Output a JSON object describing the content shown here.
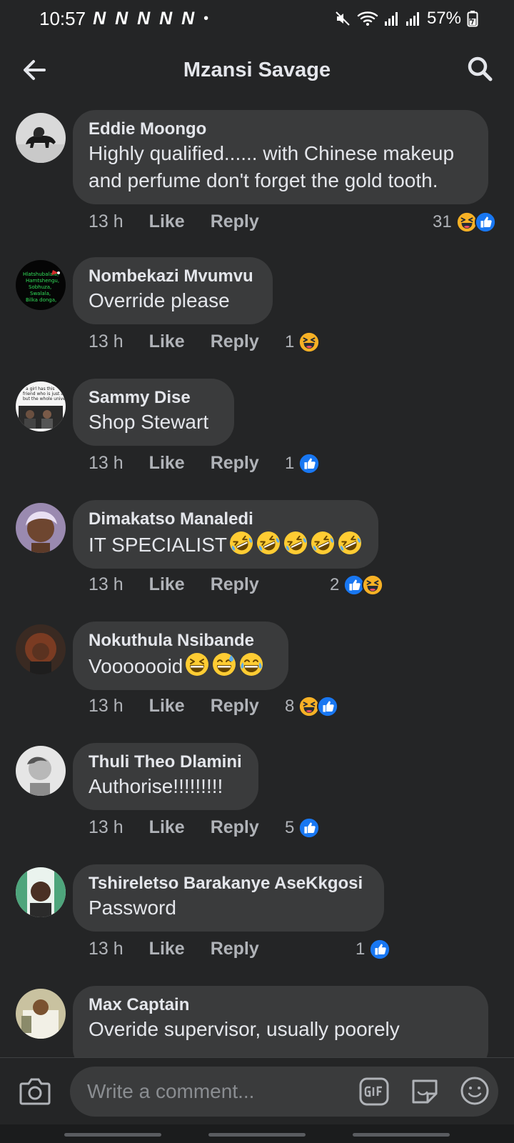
{
  "status_bar": {
    "time": "10:57",
    "notification_icons": "N N N N N",
    "dot": "•",
    "battery": "57%"
  },
  "header": {
    "title": "Mzansi Savage"
  },
  "comments": [
    {
      "author": "Eddie Moongo",
      "text": "Highly qualified...... with Chinese makeup\nand perfume don't forget the gold tooth.",
      "time": "13 h",
      "like": "Like",
      "reply": "Reply",
      "reaction_count": "31",
      "reactions": [
        "haha",
        "like"
      ]
    },
    {
      "author": "Nombekazi Mvumvu",
      "text": "Override please",
      "time": "13 h",
      "like": "Like",
      "reply": "Reply",
      "reaction_count": "1",
      "reactions": [
        "haha"
      ]
    },
    {
      "author": "Sammy Dise",
      "text": "Shop Stewart",
      "time": "13 h",
      "like": "Like",
      "reply": "Reply",
      "reaction_count": "1",
      "reactions": [
        "like"
      ]
    },
    {
      "author": "Dimakatso Manaledi",
      "text": "IT SPECIALIST",
      "text_emoji": [
        "rofl",
        "rofl",
        "rofl",
        "rofl",
        "rofl"
      ],
      "time": "13 h",
      "like": "Like",
      "reply": "Reply",
      "reaction_count": "2",
      "reactions": [
        "like",
        "haha"
      ]
    },
    {
      "author": "Nokuthula Nsibande",
      "text": "Vooooooid",
      "text_emoji": [
        "grin-squint",
        "sweat-smile",
        "joy"
      ],
      "time": "13 h",
      "like": "Like",
      "reply": "Reply",
      "reaction_count": "8",
      "reactions": [
        "haha",
        "like"
      ]
    },
    {
      "author": "Thuli Theo Dlamini",
      "text": "Authorise!!!!!!!!!",
      "time": "13 h",
      "like": "Like",
      "reply": "Reply",
      "reaction_count": "5",
      "reactions": [
        "like"
      ]
    },
    {
      "author": "Tshireletso Barakanye AseKkgosi",
      "text": "Password",
      "time": "13 h",
      "like": "Like",
      "reply": "Reply",
      "reaction_count": "1",
      "reactions": [
        "like"
      ]
    },
    {
      "author": "Max Captain",
      "text": "Overide supervisor, usually poorely"
    }
  ],
  "composer": {
    "placeholder": "Write a comment..."
  },
  "colors": {
    "background": "#242526",
    "bubble": "#3a3b3c",
    "text_primary": "#e4e6eb",
    "text_secondary": "#b0b3b8",
    "like_blue": "#1877f2",
    "haha_yellow": "#f7b125"
  },
  "icons": {
    "back": "arrow-left-icon",
    "search": "search-icon",
    "camera": "camera-icon",
    "gif": "gif-icon",
    "sticker": "sticker-icon",
    "emoji": "smiley-icon"
  }
}
